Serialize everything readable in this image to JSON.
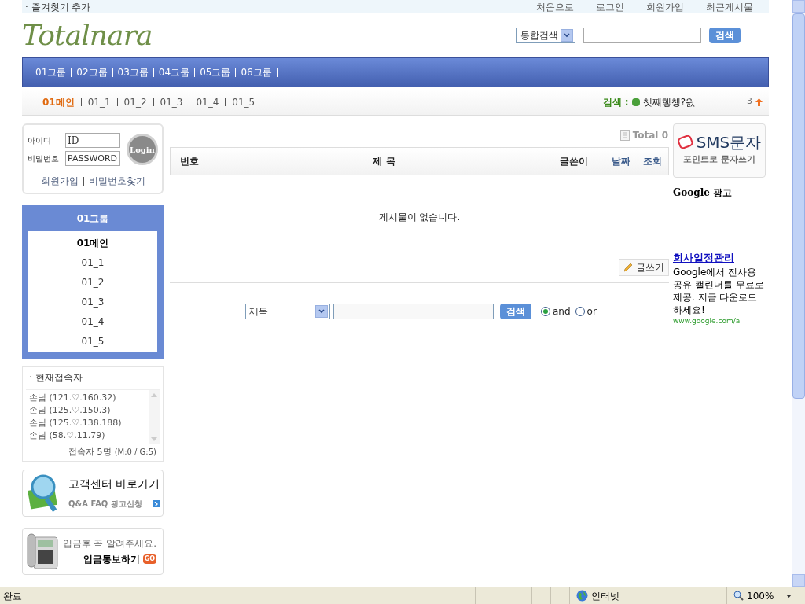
{
  "top_bar": {
    "bookmark": "· 즐겨찾기 추가",
    "links": [
      "처음으로",
      "로그인",
      "회원가입",
      "최근게시물"
    ]
  },
  "logo": "Totalnara",
  "header_search": {
    "scope": "통합검색",
    "button": "검색"
  },
  "main_nav": [
    "01그룹",
    "02그룹",
    "03그룹",
    "04그룹",
    "05그룹",
    "06그룹"
  ],
  "sub_nav": {
    "items": [
      {
        "label": "01메인",
        "selected": true
      },
      {
        "label": "01_1",
        "selected": false
      },
      {
        "label": "01_2",
        "selected": false
      },
      {
        "label": "01_3",
        "selected": false
      },
      {
        "label": "01_4",
        "selected": false
      },
      {
        "label": "01_5",
        "selected": false
      }
    ],
    "search_label": "검색 :",
    "search_term": "챗쨰햏챙?왌",
    "rank": "3"
  },
  "login": {
    "id_label": "아이디",
    "id_value": "ID",
    "pw_label": "비밀번호",
    "pw_value": "PASSWORD",
    "button": "Login",
    "links": [
      "회원가입",
      "비밀번호찾기"
    ]
  },
  "side_menu": {
    "title": "01그룹",
    "items": [
      {
        "label": "01메인",
        "selected": true
      },
      {
        "label": "01_1",
        "selected": false
      },
      {
        "label": "01_2",
        "selected": false
      },
      {
        "label": "01_3",
        "selected": false
      },
      {
        "label": "01_4",
        "selected": false
      },
      {
        "label": "01_5",
        "selected": false
      }
    ]
  },
  "visitors": {
    "title": "· 현재접속자",
    "list": [
      "손님 (121.♡.160.32)",
      "손님 (125.♡.150.3)",
      "손님 (125.♡.138.188)",
      "손님 (58.♡.11.79)"
    ],
    "summary": "접속자 5명",
    "detail": "(M:0 / G:5)"
  },
  "support_banner": {
    "title": "고객센터 바로가기",
    "subtitle": "Q&A FAQ 광고신청"
  },
  "deposit_banner": {
    "text": "입금후 꼭 알려주세요.",
    "title": "입금통보하기",
    "badge": "GO"
  },
  "board": {
    "total": "Total 0",
    "columns": [
      {
        "label": "번호",
        "link": false
      },
      {
        "label": "제 목",
        "link": false
      },
      {
        "label": "글쓴이",
        "link": false
      },
      {
        "label": "날짜",
        "link": true
      },
      {
        "label": "조회",
        "link": true
      }
    ],
    "empty": "게시물이 없습니다.",
    "write_button": "글쓰기"
  },
  "board_search": {
    "field": "제목",
    "button": "검색",
    "options": [
      {
        "label": "and",
        "selected": true
      },
      {
        "label": "or",
        "selected": false
      }
    ]
  },
  "sms_banner": {
    "title": "SMS문자",
    "subtitle": "포인트로 문자쓰기"
  },
  "google_label": "Google 광고",
  "ad": {
    "title": "회사일정관리",
    "body": "Google에서 전사용 공유 캘린더를 무료로 제공. 지금 다운로드 하세요!",
    "url": "www.google.com/a"
  },
  "status_bar": {
    "status": "완료",
    "zone": "인터넷",
    "zoom": "100%"
  }
}
